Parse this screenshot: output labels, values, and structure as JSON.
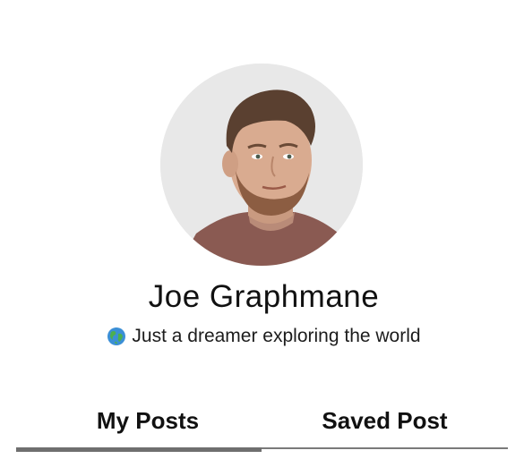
{
  "profile": {
    "name": "Joe Graphmane",
    "bio_emoji": "globe-icon",
    "bio": "Just a dreamer exploring the world",
    "avatar": "avatar"
  },
  "tabs": [
    {
      "label": "My Posts",
      "active": true
    },
    {
      "label": "Saved Post",
      "active": false
    }
  ],
  "colors": {
    "text": "#111111",
    "indicator": "#6f6f6f",
    "track": "#7a7a7a",
    "avatar_bg": "#ececec"
  }
}
